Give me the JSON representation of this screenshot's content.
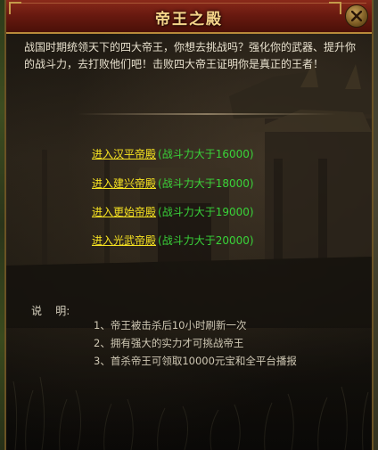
{
  "dialog": {
    "title": "帝王之殿",
    "intro": "战国时期统领天下的四大帝王，你想去挑战吗？强化你的武器、提升你的战斗力，去打败他们吧！击败四大帝王证明你是真正的王者！"
  },
  "entries": [
    {
      "link": "进入汉平帝殿",
      "requirement": "(战斗力大于16000)"
    },
    {
      "link": "进入建兴帝殿",
      "requirement": "(战斗力大于18000)"
    },
    {
      "link": "进入更始帝殿",
      "requirement": "(战斗力大于19000)"
    },
    {
      "link": "进入光武帝殿",
      "requirement": "(战斗力大于20000)"
    }
  ],
  "notes": {
    "label": "说    明:",
    "items": [
      "1、帝王被击杀后10小时刷新一次",
      "2、拥有强大的实力才可挑战帝王",
      "3、首杀帝王可领取10000元宝和全平台播报"
    ]
  },
  "colors": {
    "title_text": "#f5d58a",
    "link": "#f7e321",
    "requirement": "#39d339",
    "body_text": "#e9e2cf"
  },
  "icons": {
    "close": "close-icon"
  }
}
